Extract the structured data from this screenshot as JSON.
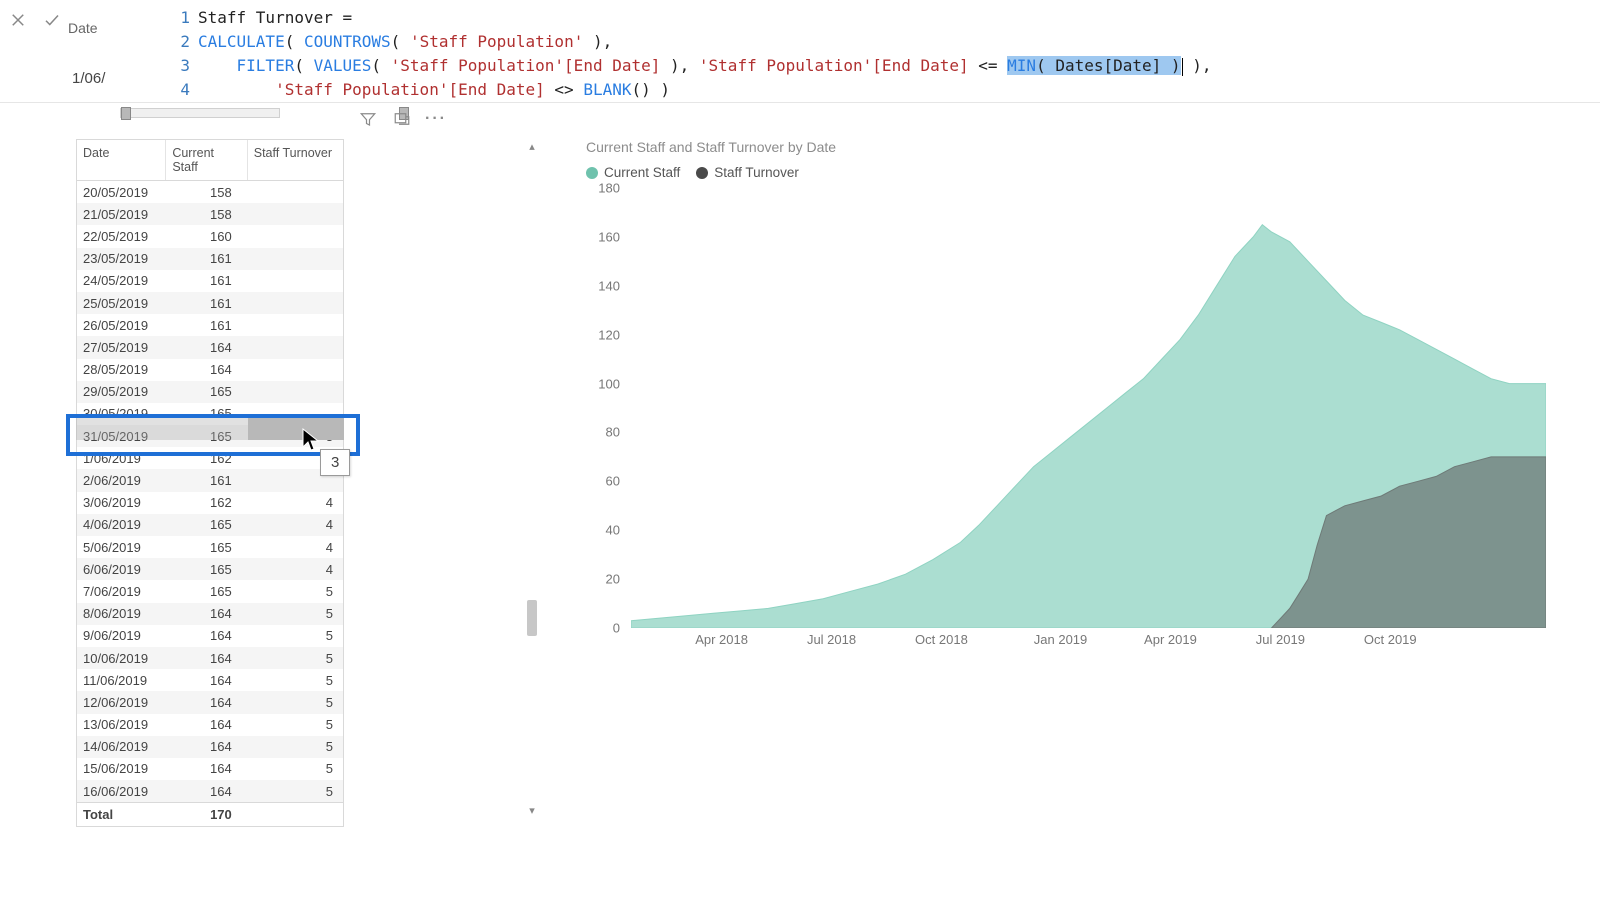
{
  "slicer": {
    "label": "Date",
    "value": "1/06/"
  },
  "formula": {
    "lines": [
      "1",
      "2",
      "3",
      "4"
    ],
    "line1_measure": "Staff Turnover",
    "line1_eq": " =",
    "line2_calc": "CALCULATE",
    "line2_countrows": "COUNTROWS",
    "line2_arg": "'Staff Population'",
    "line3_filter": "FILTER",
    "line3_values": "VALUES",
    "line3_col": "'Staff Population'[End Date]",
    "line3_min": "MIN",
    "line3_min_arg": "Dates[Date]",
    "line4_col": "'Staff Population'[End Date]",
    "line4_blank": "BLANK"
  },
  "table": {
    "headers": {
      "date": "Date",
      "current": "Current Staff",
      "turnover": "Staff Turnover"
    },
    "rows": [
      {
        "date": "20/05/2019",
        "current": "158",
        "turnover": ""
      },
      {
        "date": "21/05/2019",
        "current": "158",
        "turnover": ""
      },
      {
        "date": "22/05/2019",
        "current": "160",
        "turnover": ""
      },
      {
        "date": "23/05/2019",
        "current": "161",
        "turnover": ""
      },
      {
        "date": "24/05/2019",
        "current": "161",
        "turnover": ""
      },
      {
        "date": "25/05/2019",
        "current": "161",
        "turnover": ""
      },
      {
        "date": "26/05/2019",
        "current": "161",
        "turnover": ""
      },
      {
        "date": "27/05/2019",
        "current": "164",
        "turnover": ""
      },
      {
        "date": "28/05/2019",
        "current": "164",
        "turnover": ""
      },
      {
        "date": "29/05/2019",
        "current": "165",
        "turnover": ""
      },
      {
        "date": "30/05/2019",
        "current": "165",
        "turnover": ""
      },
      {
        "date": "31/05/2019",
        "current": "165",
        "turnover": "3"
      },
      {
        "date": "1/06/2019",
        "current": "162",
        "turnover": ""
      },
      {
        "date": "2/06/2019",
        "current": "161",
        "turnover": ""
      },
      {
        "date": "3/06/2019",
        "current": "162",
        "turnover": "4"
      },
      {
        "date": "4/06/2019",
        "current": "165",
        "turnover": "4"
      },
      {
        "date": "5/06/2019",
        "current": "165",
        "turnover": "4"
      },
      {
        "date": "6/06/2019",
        "current": "165",
        "turnover": "4"
      },
      {
        "date": "7/06/2019",
        "current": "165",
        "turnover": "5"
      },
      {
        "date": "8/06/2019",
        "current": "164",
        "turnover": "5"
      },
      {
        "date": "9/06/2019",
        "current": "164",
        "turnover": "5"
      },
      {
        "date": "10/06/2019",
        "current": "164",
        "turnover": "5"
      },
      {
        "date": "11/06/2019",
        "current": "164",
        "turnover": "5"
      },
      {
        "date": "12/06/2019",
        "current": "164",
        "turnover": "5"
      },
      {
        "date": "13/06/2019",
        "current": "164",
        "turnover": "5"
      },
      {
        "date": "14/06/2019",
        "current": "164",
        "turnover": "5"
      },
      {
        "date": "15/06/2019",
        "current": "164",
        "turnover": "5"
      },
      {
        "date": "16/06/2019",
        "current": "164",
        "turnover": "5"
      }
    ],
    "total_label": "Total",
    "total_current": "170",
    "tooltip": "3"
  },
  "chart_title": "Current Staff and Staff Turnover by Date",
  "legend": {
    "current": "Current Staff",
    "turnover": "Staff Turnover"
  },
  "chart_data": {
    "type": "area",
    "xlabel": "",
    "ylabel": "",
    "ylim": [
      0,
      180
    ],
    "y_ticks": [
      0,
      20,
      40,
      60,
      80,
      100,
      120,
      140,
      160,
      180
    ],
    "x_ticks": [
      "Apr 2018",
      "Jul 2018",
      "Oct 2018",
      "Jan 2019",
      "Apr 2019",
      "Jul 2019",
      "Oct 2019"
    ],
    "series": [
      {
        "name": "Current Staff",
        "color": "#8fd3c2",
        "points": [
          [
            0,
            3
          ],
          [
            3,
            4
          ],
          [
            6,
            5
          ],
          [
            9,
            6
          ],
          [
            12,
            7
          ],
          [
            15,
            8
          ],
          [
            18,
            10
          ],
          [
            21,
            12
          ],
          [
            24,
            15
          ],
          [
            27,
            18
          ],
          [
            30,
            22
          ],
          [
            33,
            28
          ],
          [
            36,
            35
          ],
          [
            38,
            42
          ],
          [
            40,
            50
          ],
          [
            42,
            58
          ],
          [
            44,
            66
          ],
          [
            46,
            72
          ],
          [
            48,
            78
          ],
          [
            50,
            84
          ],
          [
            52,
            90
          ],
          [
            54,
            96
          ],
          [
            56,
            102
          ],
          [
            58,
            110
          ],
          [
            60,
            118
          ],
          [
            62,
            128
          ],
          [
            64,
            140
          ],
          [
            66,
            152
          ],
          [
            68,
            160
          ],
          [
            69,
            165
          ],
          [
            70,
            162
          ],
          [
            72,
            158
          ],
          [
            74,
            150
          ],
          [
            76,
            142
          ],
          [
            78,
            134
          ],
          [
            80,
            128
          ],
          [
            82,
            125
          ],
          [
            84,
            122
          ],
          [
            86,
            118
          ],
          [
            88,
            114
          ],
          [
            90,
            110
          ],
          [
            92,
            106
          ],
          [
            94,
            102
          ],
          [
            96,
            100
          ],
          [
            98,
            100
          ],
          [
            100,
            100
          ]
        ]
      },
      {
        "name": "Staff Turnover",
        "color": "#6e7a77",
        "points": [
          [
            70,
            0
          ],
          [
            71,
            4
          ],
          [
            72,
            8
          ],
          [
            73,
            14
          ],
          [
            74,
            20
          ],
          [
            75,
            34
          ],
          [
            76,
            46
          ],
          [
            77,
            48
          ],
          [
            78,
            50
          ],
          [
            80,
            52
          ],
          [
            82,
            54
          ],
          [
            84,
            58
          ],
          [
            86,
            60
          ],
          [
            88,
            62
          ],
          [
            90,
            66
          ],
          [
            92,
            68
          ],
          [
            94,
            70
          ],
          [
            96,
            70
          ],
          [
            98,
            70
          ],
          [
            100,
            70
          ]
        ]
      }
    ]
  }
}
